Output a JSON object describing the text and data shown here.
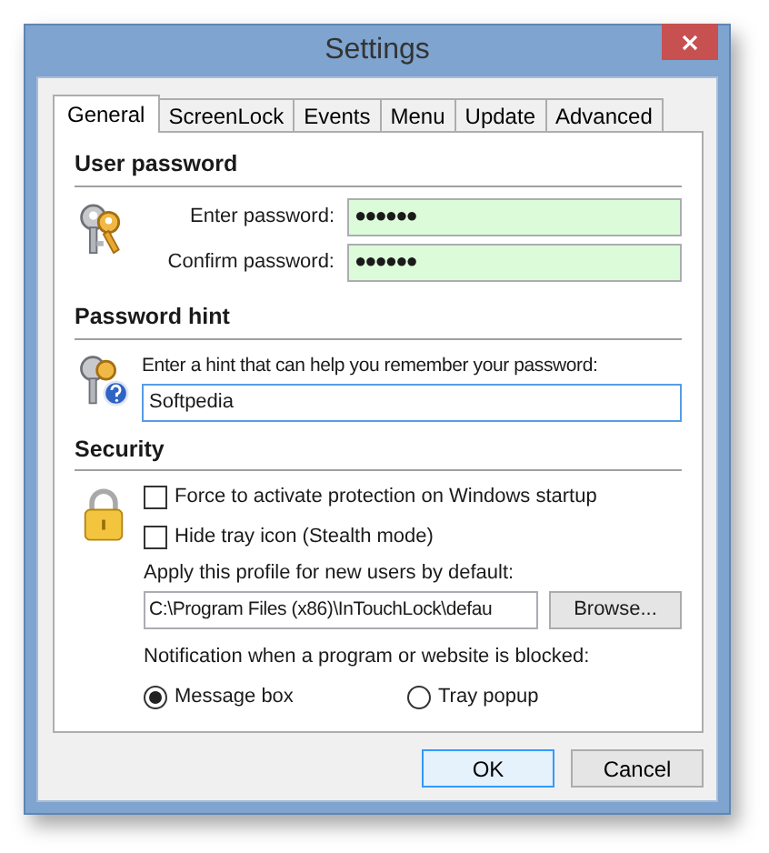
{
  "window": {
    "title": "Settings"
  },
  "tabs": [
    {
      "label": "General",
      "selected": true
    },
    {
      "label": "ScreenLock",
      "selected": false
    },
    {
      "label": "Events",
      "selected": false
    },
    {
      "label": "Menu",
      "selected": false
    },
    {
      "label": "Update",
      "selected": false
    },
    {
      "label": "Advanced",
      "selected": false
    }
  ],
  "user_password": {
    "title": "User password",
    "fields": [
      {
        "label": "Enter password:",
        "value": "●●●●●●"
      },
      {
        "label": "Confirm password:",
        "value": "●●●●●●"
      }
    ]
  },
  "password_hint": {
    "title": "Password hint",
    "prompt": "Enter a hint that can help you remember your password:",
    "value": "Softpedia"
  },
  "security": {
    "title": "Security",
    "checkboxes": [
      {
        "label": "Force to activate protection on Windows startup",
        "checked": false
      },
      {
        "label": "Hide tray icon (Stealth mode)",
        "checked": false
      }
    ],
    "profile_label": "Apply this profile for new users by default:",
    "profile_path": "C:\\Program Files (x86)\\InTouchLock\\defau",
    "browse_button": "Browse...",
    "notification_label": "Notification when a program or website is blocked:",
    "radios": [
      {
        "label": "Message box",
        "selected": true
      },
      {
        "label": "Tray popup",
        "selected": false
      }
    ]
  },
  "buttons": [
    {
      "label": "OK",
      "focused": true
    },
    {
      "label": "Cancel",
      "focused": false
    }
  ]
}
